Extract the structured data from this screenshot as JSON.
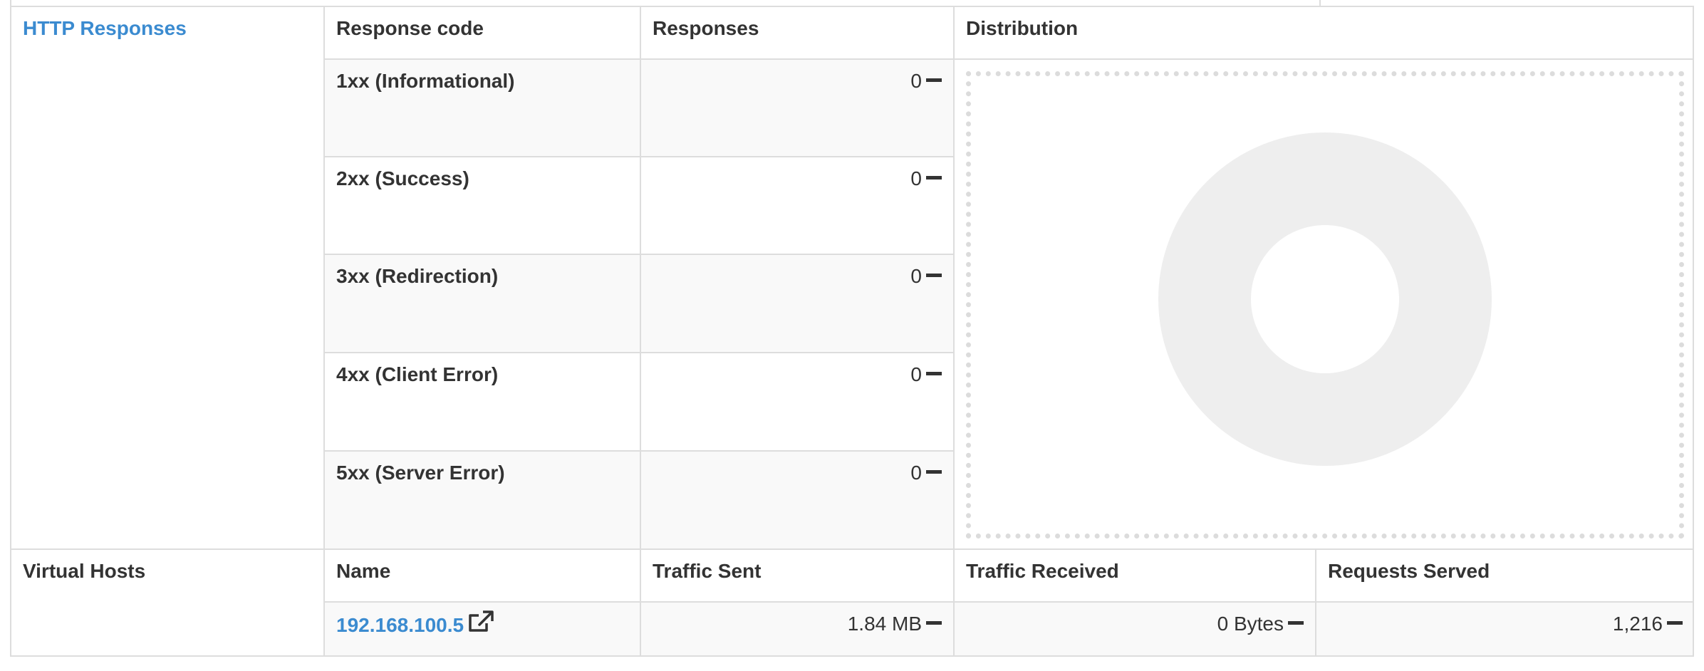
{
  "http": {
    "section_title": "HTTP Responses",
    "headers": {
      "code": "Response code",
      "responses": "Responses",
      "distribution": "Distribution"
    },
    "rows": [
      {
        "code": "1xx (Informational)",
        "count": "0"
      },
      {
        "code": "2xx (Success)",
        "count": "0"
      },
      {
        "code": "3xx (Redirection)",
        "count": "0"
      },
      {
        "code": "4xx (Client Error)",
        "count": "0"
      },
      {
        "code": "5xx (Server Error)",
        "count": "0"
      }
    ],
    "distribution_chart": {
      "type": "donut",
      "state": "empty",
      "color": "#eeeeee"
    }
  },
  "vhosts": {
    "section_title": "Virtual Hosts",
    "headers": {
      "name": "Name",
      "sent": "Traffic Sent",
      "received": "Traffic Received",
      "served": "Requests Served"
    },
    "rows": [
      {
        "name": "192.168.100.5",
        "sent": "1.84 MB",
        "received": "0 Bytes",
        "served": "1,216"
      }
    ]
  },
  "colors": {
    "link": "#3b8bd0",
    "border": "#dddddd",
    "stripe": "#f9f9f9"
  },
  "icons": {
    "dash": "minus-icon",
    "external": "external-link-icon"
  }
}
